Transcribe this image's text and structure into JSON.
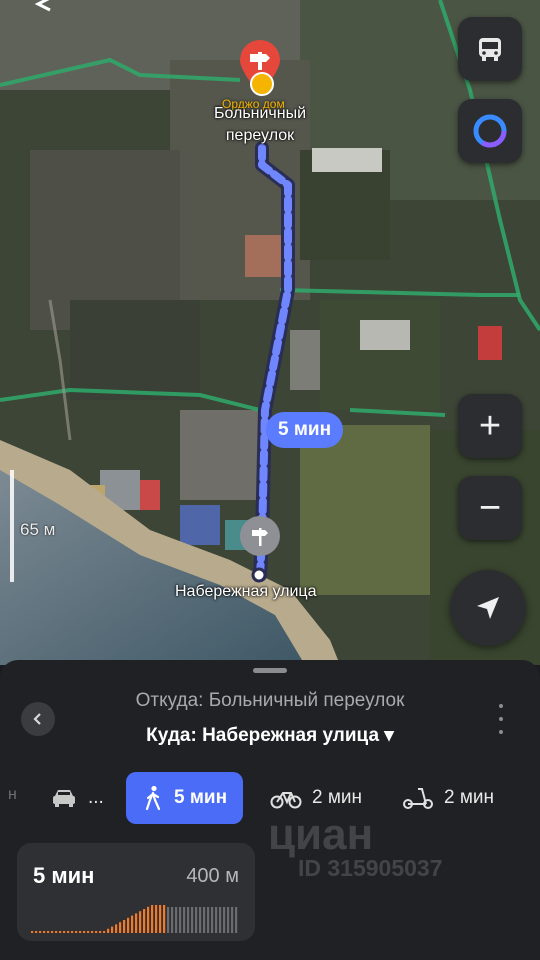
{
  "map": {
    "start_label": "Больничный\nпереулок",
    "start_label_line1": "Больничный",
    "start_label_line2": "переулок",
    "poi_label": "Орджо дом",
    "end_label": "Набережная улица",
    "eta_bubble": "5 мин",
    "scale_label": "65 м",
    "route_color": "#5b7cff",
    "route_dash_color": "#9fb0ff"
  },
  "controls": {
    "transit_icon": "bus-icon",
    "assistant_icon": "alice-icon",
    "zoom_in": "+",
    "zoom_out": "−",
    "locate_icon": "navigation-arrow-icon"
  },
  "sheet": {
    "from": "Откуда: Больничный переулок",
    "to": "Куда: Набережная улица ▾",
    "modes": [
      {
        "icon": "car-icon",
        "label": "..."
      },
      {
        "icon": "walk-icon",
        "label": "5 мин",
        "active": true
      },
      {
        "icon": "bike-icon",
        "label": "2 мин"
      },
      {
        "icon": "scooter-icon",
        "label": "2 мин"
      }
    ],
    "left_cut": "н",
    "route_card": {
      "time": "5 мин",
      "distance": "400 м"
    }
  },
  "watermark": {
    "brand": "циан",
    "id": "ID 315905037"
  },
  "colors": {
    "accent": "#4a6cf7",
    "bubble": "#5b7cff",
    "poi": "#f5b400",
    "elevation": "#f07a2a"
  }
}
